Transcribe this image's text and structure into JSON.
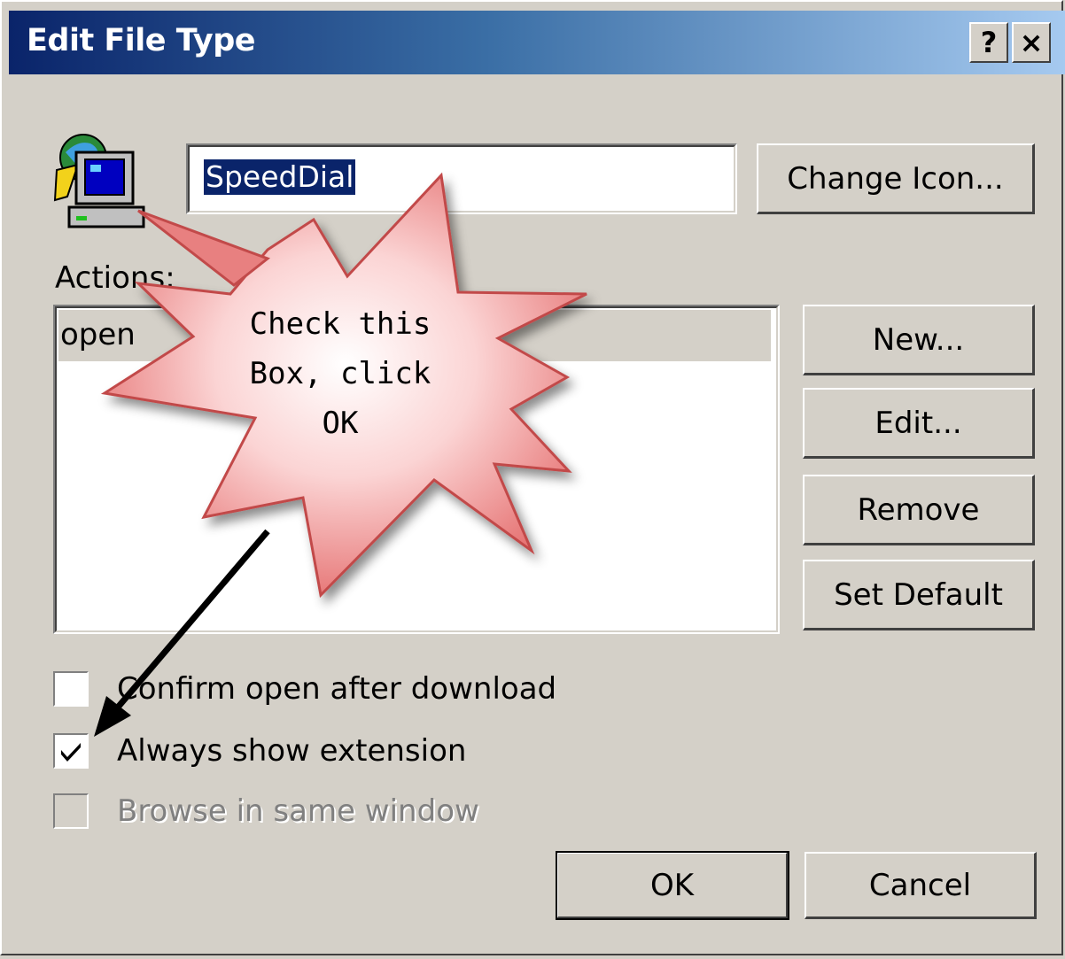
{
  "window": {
    "title": "Edit File Type",
    "help_button": "?",
    "close_button": "×"
  },
  "file_type": {
    "icon": "computer-icon",
    "name_value": "SpeedDial"
  },
  "buttons": {
    "change_icon": "Change Icon...",
    "new": "New...",
    "edit": "Edit...",
    "remove": "Remove",
    "set_default": "Set Default",
    "ok": "OK",
    "cancel": "Cancel"
  },
  "actions": {
    "label": "Actions:",
    "items": [
      "open"
    ]
  },
  "checkboxes": [
    {
      "label": "Confirm open after download",
      "checked": false,
      "disabled": false
    },
    {
      "label": "Always show extension",
      "checked": true,
      "disabled": false
    },
    {
      "label": "Browse in same window",
      "checked": false,
      "disabled": true
    }
  ],
  "callout": {
    "text": "Check this\nBox, click\nOK"
  },
  "colors": {
    "title_start": "#0a246a",
    "title_end": "#a6caf0",
    "face": "#d4d0c8",
    "selection": "#0a246a",
    "callout_fill": "#f08080"
  }
}
